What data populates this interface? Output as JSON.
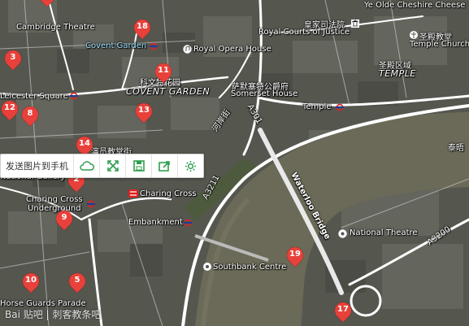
{
  "toolbar": {
    "send_label": "发送图片到手机",
    "icons": [
      "cloud-icon",
      "expand-icon",
      "save-icon",
      "share-icon",
      "settings-icon"
    ]
  },
  "labels": {
    "ye_olde": "Ye Olde Cheshire Cheese",
    "cambridge_theatre": "Cambridge Theatre",
    "royal_courts_zh": "皇家司法院",
    "royal_courts": "Royal Courts of Justice",
    "st_clement_zh": "圣殿教堂",
    "temple_church": "Temple Church",
    "covent_garden_stn": "Covent Garden",
    "royal_opera": "Royal Opera House",
    "temple_zh": "圣殿区域",
    "temple_area": "TEMPLE",
    "covent_garden_zh": "科文特花园",
    "covent_garden_area": "COVENT GARDEN",
    "somerset_zh": "萨默塞特公爵府",
    "somerset": "Somerset House",
    "leicester_square": "Leicester Square",
    "temple_stn": "Temple",
    "embankment_zh": "河岸街",
    "a301": "A301",
    "thames_zh": "泰晤",
    "actor_church_zh": "演员教堂街",
    "national_gallery": "National Gallery",
    "charing_cross_u": "Charing Cross\nUnderground",
    "charing_cross": "Charing Cross",
    "a3211": "A3211",
    "waterloo_bridge": "Waterloo Bridge",
    "embankment": "Embankment",
    "national_theatre": "National Theatre",
    "a3200": "A3200",
    "southbank_centre": "Southbank Centre",
    "horse_guards": "Horse Guards Parade"
  },
  "markers": [
    {
      "num": "18"
    },
    {
      "num": "3"
    },
    {
      "num": "11"
    },
    {
      "num": "12"
    },
    {
      "num": "8"
    },
    {
      "num": "13"
    },
    {
      "num": "14"
    },
    {
      "num": "2"
    },
    {
      "num": "9"
    },
    {
      "num": "19"
    },
    {
      "num": "10"
    },
    {
      "num": "5"
    },
    {
      "num": "17"
    }
  ],
  "watermark": "Bai 贴吧 | 刺客教条吧",
  "colors": {
    "marker": "#e8403a",
    "river": "#6b6a58",
    "road": "#ffffff"
  }
}
